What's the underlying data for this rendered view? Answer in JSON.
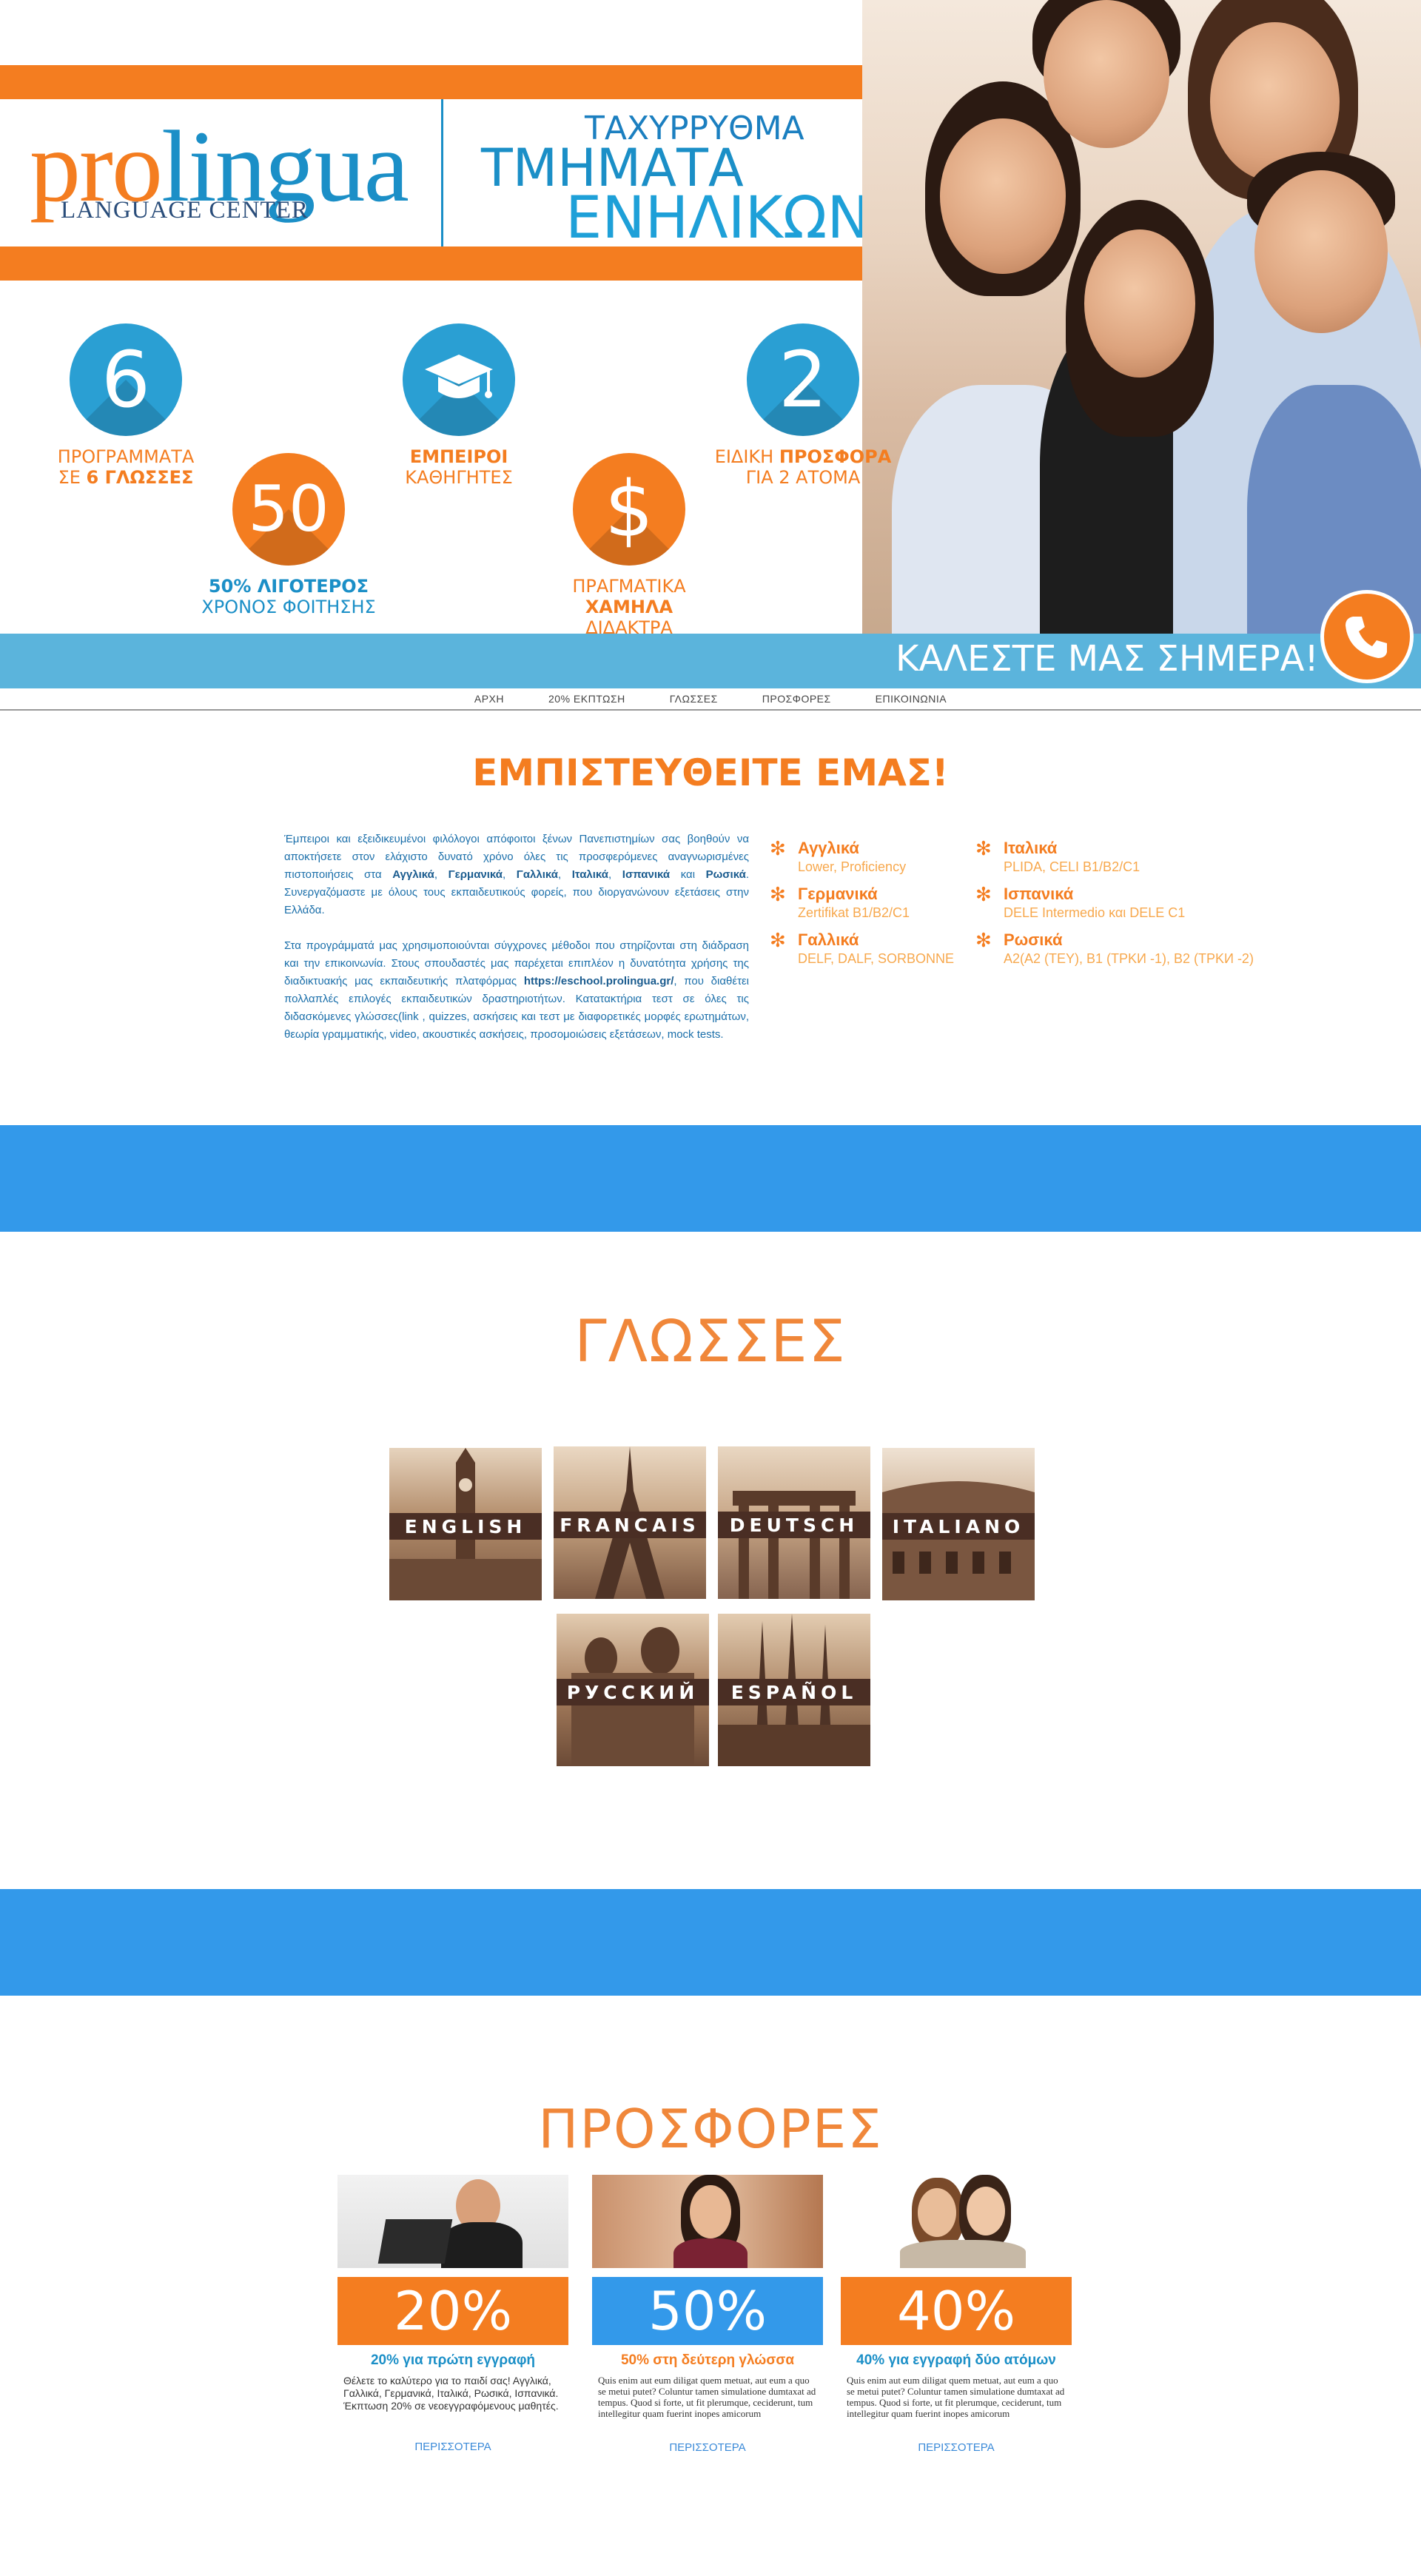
{
  "colors": {
    "orange": "#f47d20",
    "blue": "#1b8fc7",
    "strip": "#3399ea",
    "call_bar": "#5bb4dc"
  },
  "hero": {
    "logo_pro": "pro",
    "logo_lingua": "lingua",
    "logo_sub": "LANGUAGE CENTER",
    "tagline": [
      "ΤΑΧΥΡΡΥΘΜΑ",
      "ΤΜΗΜΑΤΑ",
      "ΕΝΗΛΙΚΩΝ"
    ],
    "features": [
      {
        "icon": "number-6",
        "value": "6",
        "text_a": "ΠΡΟΓΡΑΜΜΑΤΑ",
        "text_b_pre": "ΣΕ ",
        "text_b_strong": "6 ΓΛΩΣΣΕΣ"
      },
      {
        "icon": "graduation-cap-icon",
        "text_a_strong": "ΕΜΠΕΙΡΟΙ",
        "text_b": "ΚΑΘΗΓΗΤΕΣ"
      },
      {
        "icon": "number-2",
        "value": "2",
        "text_a_pre": "ΕΙΔΙΚΗ ",
        "text_a_strong": "ΠΡΟΣΦΟΡΑ",
        "text_b": "ΓΙΑ 2 ΑΤΟΜΑ"
      },
      {
        "icon": "number-50",
        "value": "50",
        "text_a_strong": "50% ΛΙΓΟΤΕΡΟΣ",
        "text_b": "ΧΡΟΝΟΣ ΦΟΙΤΗΣΗΣ"
      },
      {
        "icon": "dollar-icon",
        "value": "$",
        "text_a": "ΠΡΑΓΜΑΤΙΚΑ",
        "text_b_strong": "ΧΑΜΗΛΑ",
        "text_b_post": " ΔΙΔΑΚΤΡΑ"
      }
    ],
    "call_text": "ΚΑΛΕΣΤΕ ΜΑΣ ΣΗΜΕΡΑ!"
  },
  "nav": [
    "ΑΡΧΗ",
    "20% ΕΚΠΤΩΣΗ",
    "ΓΛΩΣΣΕΣ",
    "ΠΡΟΣΦΟΡΕΣ",
    "ΕΠΙΚΟΙΝΩΝΙΑ"
  ],
  "trust": {
    "title": "ΕΜΠΙΣΤΕΥΘΕΙΤΕ ΕΜΑΣ!",
    "p1_pre": "Έμπειροι και εξειδικευμένοι φιλόλογοι απόφοιτοι ξένων Πανεπιστημίων σας βοηθούν να αποκτήσετε στον ελάχιστο δυνατό χρόνο όλες τις προσφερόμενες αναγνωρισμένες πιστοποιήσεις στα ",
    "p1_langs1": "Αγγλικά",
    "p1_sep1": ", ",
    "p1_langs2": "Γερμανικά",
    "p1_sep2": ", ",
    "p1_langs3": "Γαλλικά",
    "p1_sep3": ", ",
    "p1_langs4": "Ιταλικά",
    "p1_sep4": ", ",
    "p1_langs5": "Ισπανικά",
    "p1_sep5": " και ",
    "p1_langs6": "Ρωσικά",
    "p1_post": ". Συνεργαζόμαστε με όλους τους εκπαιδευτικούς φορείς, που διοργανώνουν εξετάσεις στην Ελλάδα.",
    "p2_pre": "Στα προγράμματά μας χρησιμοποιούνται σύγχρονες μέθοδοι που στηρίζονται στη διάδραση και την επικοινωνία. Στους σπουδαστές μας παρέχεται επιπλέον η δυνατότητα χρήσης της διαδικτυακής μας εκπαιδευτικής πλατφόρμας ",
    "p2_link": "https://eschool.prolingua.gr/",
    "p2_post": ", που διαθέτει πολλαπλές επιλογές εκπαιδευτικών δραστηριοτήτων. Κατατακτήρια τεστ σε όλες τις διδασκόμενες γλώσσες(link   , quizzes, ασκήσεις και τεστ με διαφορετικές μορφές ερωτημάτων, θεωρία γραμματικής, video, ακουστικές ασκήσεις, προσομοιώσεις εξετάσεων, mock tests.",
    "languages_left": [
      {
        "name": "Αγγλικά",
        "level": "Lower, Proficiency"
      },
      {
        "name": "Γερμανικά",
        "level": "Zertifikat B1/B2/C1"
      },
      {
        "name": "Γαλλικά",
        "level": "DELF, DALF, SORBONNE"
      }
    ],
    "languages_right": [
      {
        "name": "Ιταλικά",
        "level": "PLIDA, CELI B1/B2/C1"
      },
      {
        "name": "Ισπανικά",
        "level": "DELE Intermedio και DELE C1"
      },
      {
        "name": "Ρωσικά",
        "level": "A2(A2 (ΤΕΥ), B1 (ΤΡΚИ -1), B2 (ΤΡΚИ -2)"
      }
    ]
  },
  "languages": {
    "title": "ΓΛΩΣΣΕΣ",
    "tiles": [
      "ENGLISH",
      "FRANCAIS",
      "DEUTSCH",
      "ITALIANO",
      "РУССКИЙ",
      "ESPAÑOL"
    ]
  },
  "offers": {
    "title": "ΠΡΟΣΦΟΡΕΣ",
    "items": [
      {
        "pct": "20%",
        "title": "20% για πρώτη εγγραφή",
        "desc": "Θέλετε το καλύτερο για το παιδί σας! Αγγλικά, Γαλλικά, Γερμανικά, Ιταλικά, Ρωσικά, Ισπανικά. Έκπτωση 20% σε νεοεγγραφόμενους μαθητές.",
        "more": "ΠΕΡΙΣΣΟΤΕΡΑ",
        "color": "orange"
      },
      {
        "pct": "50%",
        "title": "50% στη δεύτερη γλώσσα",
        "desc": "Quis enim aut eum diligat quem metuat, aut eum a quo se metui putet? Coluntur tamen simulatione dumtaxat ad tempus. Quod si forte, ut fit plerumque, ceciderunt, tum intellegitur quam fuerint inopes amicorum",
        "more": "ΠΕΡΙΣΣΟΤΕΡΑ",
        "color": "blue"
      },
      {
        "pct": "40%",
        "title": "40% για εγγραφή δύο ατόμων",
        "desc": "Quis enim aut eum diligat quem metuat, aut eum a quo se metui putet? Coluntur tamen simulatione dumtaxat ad tempus. Quod si forte, ut fit plerumque, ceciderunt, tum intellegitur quam fuerint inopes amicorum",
        "more": "ΠΕΡΙΣΣΟΤΕΡΑ",
        "color": "orange"
      }
    ]
  }
}
